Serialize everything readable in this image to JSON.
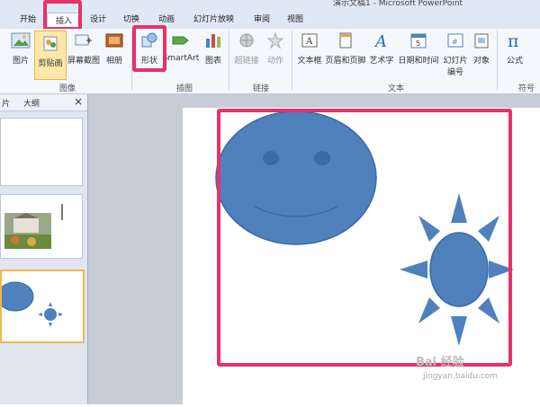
{
  "window": {
    "title": "演示文稿1 - Microsoft PowerPoint"
  },
  "tabs": [
    {
      "label": "开始"
    },
    {
      "label": "插入"
    },
    {
      "label": "设计"
    },
    {
      "label": "切换"
    },
    {
      "label": "动画"
    },
    {
      "label": "幻灯片放映"
    },
    {
      "label": "审阅"
    },
    {
      "label": "视图"
    }
  ],
  "ribbon": {
    "buttons": [
      {
        "label": "图片"
      },
      {
        "label": "剪贴画"
      },
      {
        "label": "屏幕截图"
      },
      {
        "label": "相册"
      },
      {
        "label": "形状"
      },
      {
        "label": "SmartArt"
      },
      {
        "label": "图表"
      },
      {
        "label": "超链接"
      },
      {
        "label": "动作"
      },
      {
        "label": "文本框"
      },
      {
        "label": "页眉和页脚"
      },
      {
        "label": "艺术字"
      },
      {
        "label": "日期和时间"
      },
      {
        "label": "幻灯片"
      },
      {
        "label": "编号"
      },
      {
        "label": "对象"
      },
      {
        "label": "公式"
      }
    ],
    "groups": [
      {
        "label": "图像"
      },
      {
        "label": "插图"
      },
      {
        "label": "链接"
      },
      {
        "label": "文本"
      },
      {
        "label": "符号"
      }
    ]
  },
  "panel": {
    "tab_outline": "大纲",
    "tab_slides": "片",
    "close": "×"
  },
  "watermark": {
    "text": "Bai 经验",
    "sub": "jingyan.baidu.com"
  },
  "colors": {
    "shape_fill": "#4f81bd",
    "shape_stroke": "#3a6aa0",
    "highlight": "#e8316a"
  }
}
